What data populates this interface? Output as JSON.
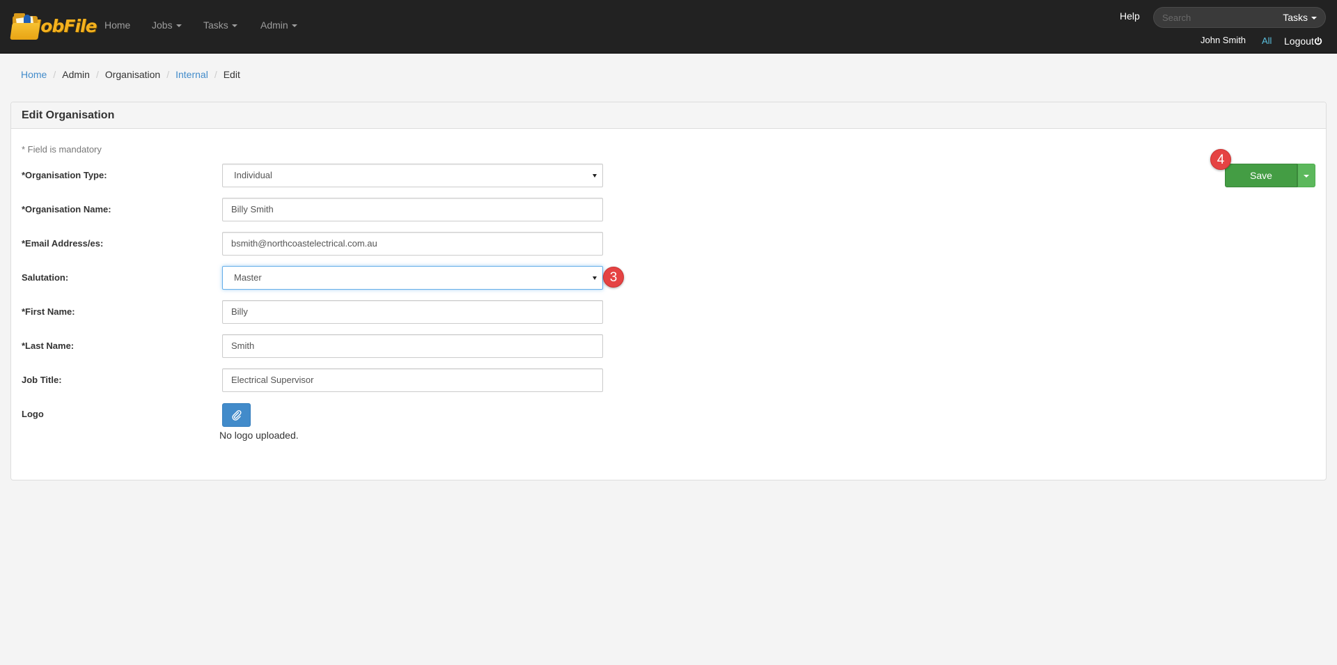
{
  "navbar": {
    "brand": "JobFile",
    "links": [
      {
        "label": "Home",
        "dropdown": false
      },
      {
        "label": "Jobs",
        "dropdown": true
      },
      {
        "label": "Tasks",
        "dropdown": true
      },
      {
        "label": "Admin",
        "dropdown": true
      }
    ],
    "help": "Help",
    "search_placeholder": "Search",
    "search_scope": "Tasks",
    "user_name": "John Smith",
    "all_link": "All",
    "logout": "Logout"
  },
  "breadcrumb": [
    {
      "label": "Home",
      "link": true
    },
    {
      "label": "Admin",
      "link": false
    },
    {
      "label": "Organisation",
      "link": false
    },
    {
      "label": "Internal",
      "link": true
    },
    {
      "label": "Edit",
      "link": false
    }
  ],
  "panel": {
    "title": "Edit Organisation",
    "mandatory_note": "* Field is mandatory"
  },
  "form": {
    "organisation_type": {
      "label": "*Organisation Type:",
      "value": "Individual"
    },
    "organisation_name": {
      "label": "*Organisation Name:",
      "value": "Billy Smith"
    },
    "email": {
      "label": "*Email Address/es:",
      "value": "bsmith@northcoastelectrical.com.au"
    },
    "salutation": {
      "label": "Salutation:",
      "value": "Master"
    },
    "first_name": {
      "label": "*First Name:",
      "value": "Billy"
    },
    "last_name": {
      "label": "*Last Name:",
      "value": "Smith"
    },
    "job_title": {
      "label": "Job Title:",
      "value": "Electrical Supervisor"
    },
    "logo": {
      "label": "Logo",
      "note": "No logo uploaded."
    }
  },
  "actions": {
    "save": "Save"
  },
  "annotations": {
    "salutation_step": "3",
    "save_step": "4"
  },
  "colors": {
    "navbar": "#222222",
    "link": "#428bca",
    "save": "#449d44",
    "badge": "#e54343"
  }
}
